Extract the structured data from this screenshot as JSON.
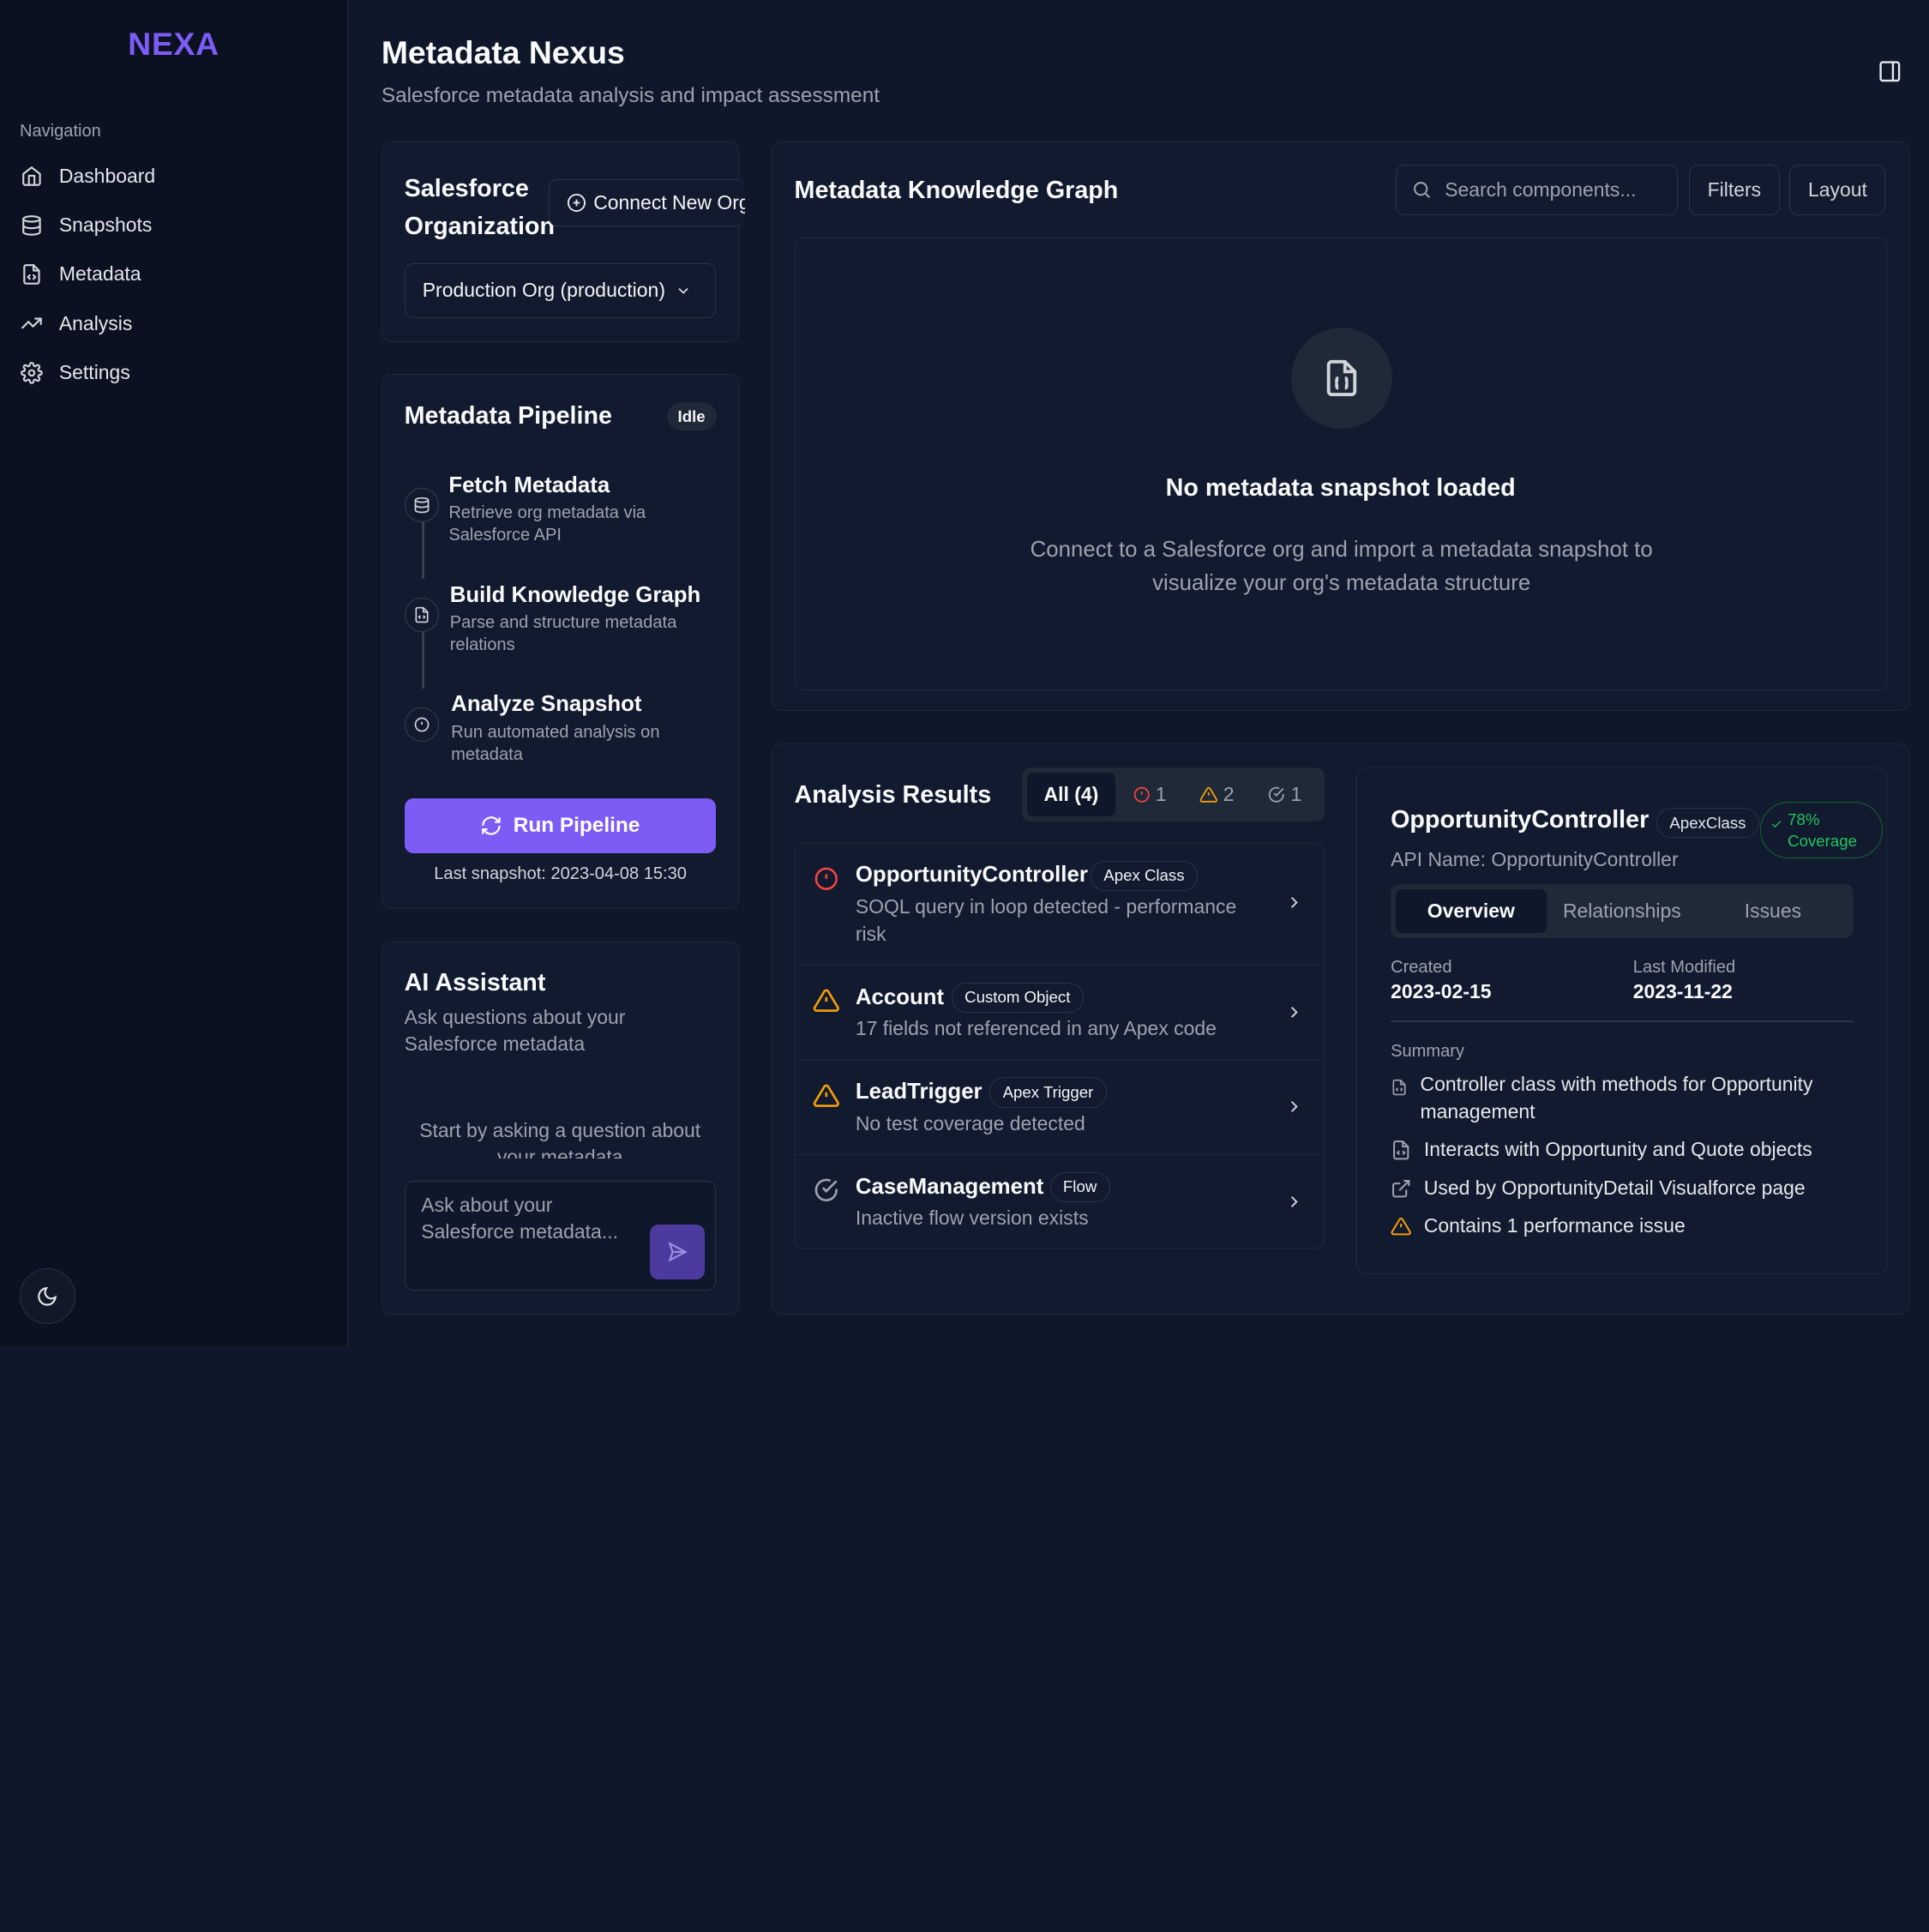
{
  "app": {
    "logo": "NEXA"
  },
  "sidebar": {
    "nav_title": "Navigation",
    "items": [
      {
        "label": "Dashboard",
        "icon": "home-icon"
      },
      {
        "label": "Snapshots",
        "icon": "database-icon"
      },
      {
        "label": "Metadata",
        "icon": "file-code-icon"
      },
      {
        "label": "Analysis",
        "icon": "trending-up-icon"
      },
      {
        "label": "Settings",
        "icon": "gear-icon"
      }
    ],
    "theme_icon": "moon-icon"
  },
  "header": {
    "title": "Metadata Nexus",
    "subtitle": "Salesforce metadata analysis and impact assessment"
  },
  "org": {
    "title": "Salesforce Organization",
    "connect_label": "Connect New Org",
    "selected": "Production Org (production)"
  },
  "pipeline": {
    "title": "Metadata Pipeline",
    "status": "Idle",
    "steps": [
      {
        "title": "Fetch Metadata",
        "desc": "Retrieve org metadata via Salesforce API"
      },
      {
        "title": "Build Knowledge Graph",
        "desc": "Parse and structure metadata relations"
      },
      {
        "title": "Analyze Snapshot",
        "desc": "Run automated analysis on metadata"
      }
    ],
    "run_label": "Run Pipeline",
    "last_snapshot": "Last snapshot: 2023-04-08 15:30"
  },
  "ai": {
    "title": "AI Assistant",
    "desc": "Ask questions about your Salesforce metadata",
    "hint": "Start by asking a question about your metadata",
    "placeholder": "Ask about your Salesforce metadata..."
  },
  "graph": {
    "title": "Metadata Knowledge Graph",
    "search_placeholder": "Search components...",
    "filters_label": "Filters",
    "layout_label": "Layout",
    "empty_title": "No metadata snapshot loaded",
    "empty_desc": "Connect to a Salesforce org and import a metadata snapshot to visualize your org's metadata structure"
  },
  "analysis": {
    "title": "Analysis Results",
    "filters": [
      {
        "label": "All (4)"
      },
      {
        "label": "1",
        "icon": "error-icon"
      },
      {
        "label": "2",
        "icon": "warning-icon"
      },
      {
        "label": "1",
        "icon": "check-icon"
      }
    ],
    "results": [
      {
        "name": "OpportunityController",
        "tag": "Apex Class",
        "desc": "SOQL query in loop detected - performance risk",
        "severity": "error"
      },
      {
        "name": "Account",
        "tag": "Custom Object",
        "desc": "17 fields not referenced in any Apex code",
        "severity": "warning"
      },
      {
        "name": "LeadTrigger",
        "tag": "Apex Trigger",
        "desc": "No test coverage detected",
        "severity": "warning"
      },
      {
        "name": "CaseManagement",
        "tag": "Flow",
        "desc": "Inactive flow version exists",
        "severity": "info"
      }
    ],
    "detail": {
      "name": "OpportunityController",
      "tag": "ApexClass",
      "coverage": "78% Coverage",
      "api_name": "API Name: OpportunityController",
      "tabs": [
        "Overview",
        "Relationships",
        "Issues"
      ],
      "created_label": "Created",
      "created": "2023-02-15",
      "modified_label": "Last Modified",
      "modified": "2023-11-22",
      "summary_label": "Summary",
      "summary": [
        {
          "text": "Controller class with methods for Opportunity management",
          "icon": "file-code-icon"
        },
        {
          "text": "Interacts with Opportunity and Quote objects",
          "icon": "file-code-icon"
        },
        {
          "text": "Used by OpportunityDetail Visualforce page",
          "icon": "external-link-icon"
        },
        {
          "text": "Contains 1 performance issue",
          "icon": "warning-icon"
        }
      ]
    }
  },
  "colors": {
    "accent": "#7c5cf5",
    "error": "#ef4444",
    "warning": "#f59e0b",
    "success": "#22c55e"
  }
}
